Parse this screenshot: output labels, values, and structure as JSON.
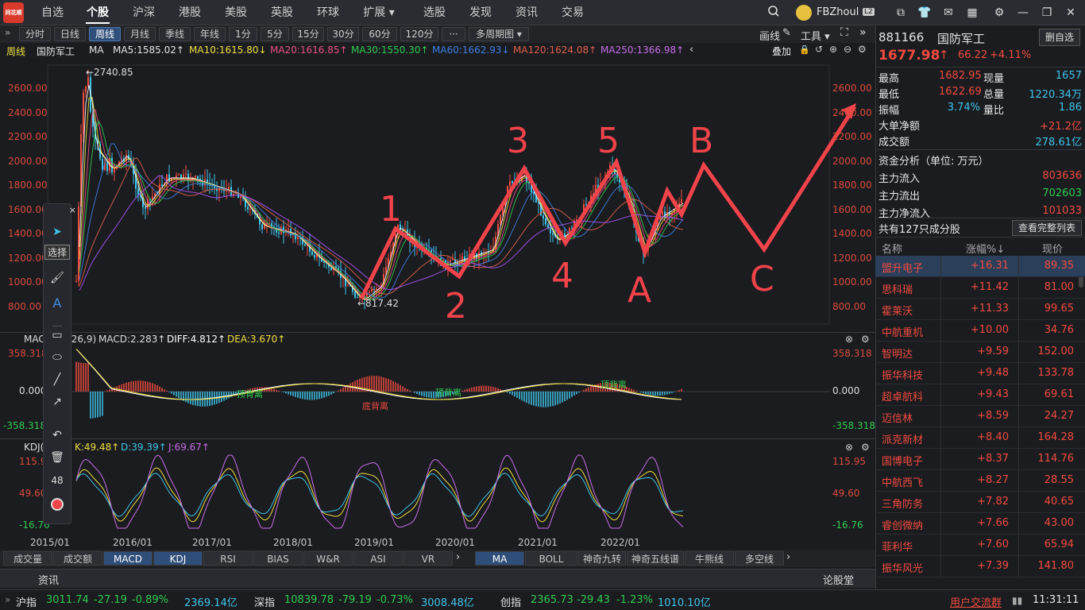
{
  "topnav": {
    "logo": "同花顺",
    "items": [
      "自选",
      "个股",
      "沪深",
      "港股",
      "美股",
      "英股",
      "环球",
      "扩展 ▾",
      "选股",
      "发现",
      "资讯",
      "交易"
    ],
    "active": "个股",
    "username": "FBZhoul",
    "level": "L2"
  },
  "periods": [
    "分时",
    "日线",
    "周线",
    "月线",
    "季线",
    "年线",
    "1分",
    "5分",
    "15分",
    "30分",
    "60分",
    "120分",
    "···",
    "多周期图 ▾"
  ],
  "period_selected": "周线",
  "tools_right": {
    "draw": "画线",
    "tools": "工具 ▾"
  },
  "ma_bar": {
    "period": "周线",
    "name": "国防军工",
    "label": "MA",
    "ma5": "MA5:1585.02↑",
    "ma10": "MA10:1615.80↓",
    "ma20": "MA20:1616.85↑",
    "ma30": "MA30:1550.30↑",
    "ma60": "MA60:1662.93↓",
    "ma120": "MA120:1624.08↑",
    "ma250": "MA250:1366.98↑",
    "overlay": "叠加"
  },
  "price_axis": [
    "2600.00",
    "2400.00",
    "2200.00",
    "2000.00",
    "1800.00",
    "1600.00",
    "1400.00",
    "1200.00",
    "1000.00",
    "800.00"
  ],
  "price_markers": {
    "high": "←2740.85",
    "low": "←817.42"
  },
  "wave_labels": [
    "1",
    "2",
    "3",
    "4",
    "5",
    "A",
    "B",
    "C"
  ],
  "macd": {
    "title": "MACD(12,26,9)",
    "macd": "MACD:2.283↑",
    "diff": "DIFF:4.812↑",
    "dea": "DEA:3.670↑",
    "axis": [
      "358.318",
      "0.000",
      "-358.318"
    ],
    "tags": {
      "top": "顶背离",
      "bottom": "底背离"
    }
  },
  "kdj": {
    "title": "KDJ(9,3,3)",
    "k": "K:49.48↑",
    "d": "D:39.39↑",
    "j": "J:69.67↑",
    "axis": [
      "115.95",
      "49.60",
      "-16.76"
    ]
  },
  "x_axis": [
    "2015/01",
    "2016/01",
    "2017/01",
    "2018/01",
    "2019/01",
    "2020/01",
    "2021/01",
    "2022/01"
  ],
  "indicator_tabs": [
    "成交量",
    "成交额",
    "MACD",
    "KDJ",
    "RSI",
    "BIAS",
    "W&R",
    "ASI",
    "VR"
  ],
  "indicator_tabs_selected": [
    "MACD",
    "KDJ"
  ],
  "overlay_tabs": [
    "MA",
    "BOLL",
    "神奇九转",
    "神奇五线谱",
    "牛熊线",
    "多空线"
  ],
  "overlay_tabs_selected": "MA",
  "info_row": {
    "left": "资讯",
    "right": "论股堂"
  },
  "drawtool": {
    "select": "选择",
    "width": "48"
  },
  "quote": {
    "code": "881166",
    "name": "国防军工",
    "delete_btn": "删自选",
    "price": "1677.98",
    "arrow": "↑",
    "change": "66.22",
    "pct": "+4.11%",
    "rows": [
      {
        "k1": "最高",
        "v1": "1682.95",
        "k2": "现量",
        "v2": "1657"
      },
      {
        "k1": "最低",
        "v1": "1622.69",
        "k2": "总量",
        "v2": "1220.34万"
      },
      {
        "k1": "振幅",
        "v1": "3.74%",
        "k2": "量比",
        "v2": "1.86"
      }
    ],
    "big_net": {
      "k": "大单净额",
      "v": "+21.2亿"
    },
    "turnover": {
      "k": "成交额",
      "v": "278.61亿"
    }
  },
  "funds": {
    "title": "资金分析（单位: 万元）",
    "inflow": {
      "k": "主力流入",
      "v": "803636"
    },
    "outflow": {
      "k": "主力流出",
      "v": "702603"
    },
    "net": {
      "k": "主力净流入",
      "v": "101033"
    }
  },
  "constituents": {
    "title": "共有127只成分股",
    "button": "查看完整列表",
    "headers": [
      "名称",
      "涨幅%↓",
      "现价"
    ],
    "rows": [
      {
        "name": "盟升电子",
        "chg": "+16.31",
        "price": "89.35"
      },
      {
        "name": "思科瑞",
        "chg": "+11.42",
        "price": "81.00"
      },
      {
        "name": "霍莱沃",
        "chg": "+11.33",
        "price": "99.65"
      },
      {
        "name": "中航重机",
        "chg": "+10.00",
        "price": "34.76"
      },
      {
        "name": "智明达",
        "chg": "+9.59",
        "price": "152.00"
      },
      {
        "name": "振华科技",
        "chg": "+9.48",
        "price": "133.78"
      },
      {
        "name": "超卓航科",
        "chg": "+9.43",
        "price": "69.61"
      },
      {
        "name": "迈信林",
        "chg": "+8.59",
        "price": "24.27"
      },
      {
        "name": "派克新材",
        "chg": "+8.40",
        "price": "164.28"
      },
      {
        "name": "国博电子",
        "chg": "+8.37",
        "price": "114.76"
      },
      {
        "name": "中航西飞",
        "chg": "+8.27",
        "price": "28.55"
      },
      {
        "name": "三角防务",
        "chg": "+7.82",
        "price": "40.65"
      },
      {
        "name": "睿创微纳",
        "chg": "+7.66",
        "price": "43.00"
      },
      {
        "name": "菲利华",
        "chg": "+7.60",
        "price": "65.94"
      },
      {
        "name": "振华风光",
        "chg": "+7.39",
        "price": "141.80"
      }
    ]
  },
  "status": {
    "sh": {
      "name": "沪指",
      "v": "3011.74",
      "c": "-27.19",
      "p": "-0.89%",
      "a": "2369.14亿"
    },
    "sz": {
      "name": "深指",
      "v": "10839.78",
      "c": "-79.19",
      "p": "-0.73%",
      "a": "3008.48亿"
    },
    "cy": {
      "name": "创指",
      "v": "2365.73",
      "c": "-29.43",
      "p": "-1.23%",
      "a": "1010.10亿"
    },
    "link": "用户交流群",
    "time": "11:31:11"
  },
  "colors": {
    "up": "#f04b3f",
    "down": "#2fcc4f",
    "accent": "#2f4f7a",
    "annot": "#f0434a"
  }
}
